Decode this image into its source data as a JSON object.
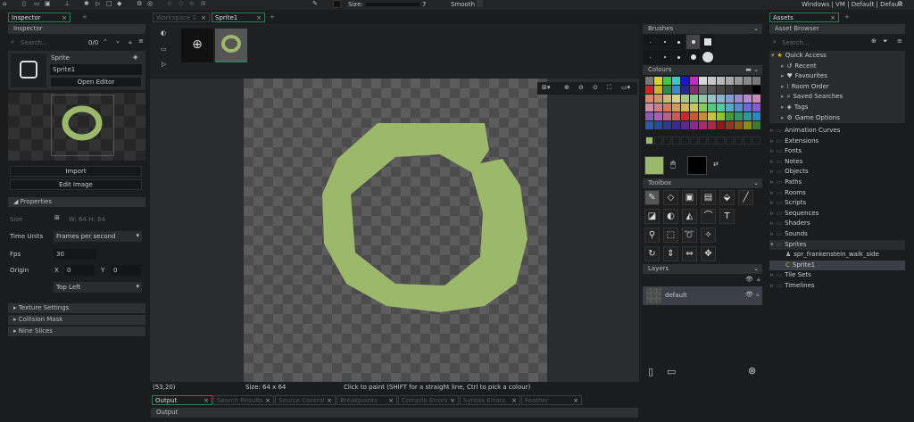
{
  "toolbar": {
    "size_label": "Size:",
    "size_value": "7",
    "smooth_label": "Smooth",
    "target": "Windows | VM | Default | Default"
  },
  "inspector": {
    "tab": "Inspector",
    "header": "Inspector",
    "search_placeholder": "Search...",
    "count": "0/0",
    "type": "Sprite",
    "name": "Sprite1",
    "open_editor": "Open Editor",
    "import": "Import",
    "edit_image": "Edit Image",
    "properties": "Properties",
    "size_label": "Size",
    "size_value": "W: 64  H: 64",
    "time_units_label": "Time Units",
    "time_units": "Frames per second",
    "fps_label": "Fps",
    "fps": "30",
    "origin_label": "Origin",
    "x_label": "X",
    "x": "0",
    "y_label": "Y",
    "y": "0",
    "origin_preset": "Top Left",
    "sections": [
      "Texture Settings",
      "Collision Mask",
      "Nine Slices"
    ]
  },
  "workspace": {
    "tabs": [
      "Workspace 1",
      "Sprite1"
    ],
    "status_pos": "(53,20)",
    "status_size": "Size: 64 x 64",
    "status_hint": "Click to paint (SHIFT for a straight line, Ctrl to pick a colour)"
  },
  "output": {
    "tabs": [
      "Output",
      "Search Results",
      "Source Control",
      "Breakpoints",
      "Compile Errors",
      "Syntax Errors",
      "Feather Messages"
    ],
    "header": "Output"
  },
  "brushes": {
    "title": "Brushes"
  },
  "colours": {
    "title": "Colours",
    "primary": "#9cb86a",
    "secondary": "#000000",
    "palette": [
      [
        "#777777",
        "#d4d42a",
        "#3fc83a",
        "#3cc8c8",
        "#1414d4",
        "#c828c8",
        "#d8d8d8",
        "#c8c8c8",
        "#b8b8b8",
        "#a8a8a8",
        "#989898",
        "#888888",
        "#787878"
      ],
      [
        "#c82828",
        "#c8b428",
        "#2a8c4a",
        "#3a8cc8",
        "#28288c",
        "#8c286e",
        "#686868",
        "#585858",
        "#484848",
        "#383838",
        "#282828",
        "#1c1c1c",
        "#000000"
      ],
      [
        "#d28a6a",
        "#d2966a",
        "#d2b478",
        "#d2d28a",
        "#a8c88a",
        "#8ac88a",
        "#8ac8a8",
        "#8ac8c8",
        "#8ab4d2",
        "#8a9ad2",
        "#9a8ad2",
        "#b48ad2",
        "#c88ab4"
      ],
      [
        "#d28aa8",
        "#d27a8a",
        "#d27a5a",
        "#d29a5a",
        "#d2b45a",
        "#c8c85a",
        "#8ac85a",
        "#5ac87a",
        "#5ac8a8",
        "#5aa8c8",
        "#5a8ad2",
        "#6a6ad2",
        "#8a5ad2"
      ],
      [
        "#8a5ab4",
        "#b45ab4",
        "#c85a8a",
        "#c85a5a",
        "#c82828",
        "#c85a28",
        "#c88c28",
        "#c8c828",
        "#8cc828",
        "#3c9c3c",
        "#289c6a",
        "#289c9c",
        "#2888c8"
      ],
      [
        "#2a5aa8",
        "#2a4a9c",
        "#2a3a8c",
        "#3a2a8c",
        "#5a2a8c",
        "#8c2a8c",
        "#a82a6a",
        "#a82a4a",
        "#8c1a1a",
        "#8c3a1a",
        "#8c5a1a",
        "#8c8c1a",
        "#3a7a2a"
      ]
    ]
  },
  "toolbox": {
    "title": "Toolbox"
  },
  "layers": {
    "title": "Layers",
    "items": [
      "default"
    ]
  },
  "assets": {
    "tab": "Assets",
    "header": "Asset Browser",
    "search_placeholder": "Search...",
    "quick_access": "Quick Access",
    "quick": [
      "Recent",
      "Favourites",
      "Room Order",
      "Saved Searches",
      "Tags",
      "Game Options"
    ],
    "folders": [
      "Animation Curves",
      "Extensions",
      "Fonts",
      "Notes",
      "Objects",
      "Paths",
      "Rooms",
      "Scripts",
      "Sequences",
      "Shaders",
      "Sounds",
      "Sprites"
    ],
    "sprites": [
      "spr_frankenstein_walk_side",
      "Sprite1"
    ],
    "folders_after": [
      "Tile Sets",
      "Timelines"
    ]
  }
}
